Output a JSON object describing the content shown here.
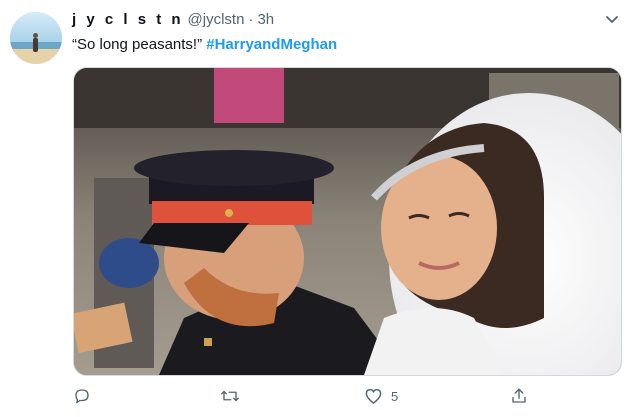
{
  "author": {
    "display_name": "j y c l s t n",
    "handle": "@jyclstn",
    "separator": "·",
    "time": "3h",
    "avatar_icon": "beach-avatar"
  },
  "tweet": {
    "text": "“So long peasants!” ",
    "hashtag": "#HarryandMeghan",
    "hashtag_color": "#1d9bf0"
  },
  "media": {
    "kind": "photo",
    "description_icon": "wedding-photo"
  },
  "actions": {
    "reply": {
      "icon": "reply-icon",
      "count": ""
    },
    "retweet": {
      "icon": "retweet-icon",
      "count": ""
    },
    "like": {
      "icon": "heart-icon",
      "count": "5"
    },
    "share": {
      "icon": "share-icon",
      "count": ""
    }
  },
  "colors": {
    "text": "#0f1419",
    "secondary": "#536471",
    "accent": "#1d9bf0"
  }
}
